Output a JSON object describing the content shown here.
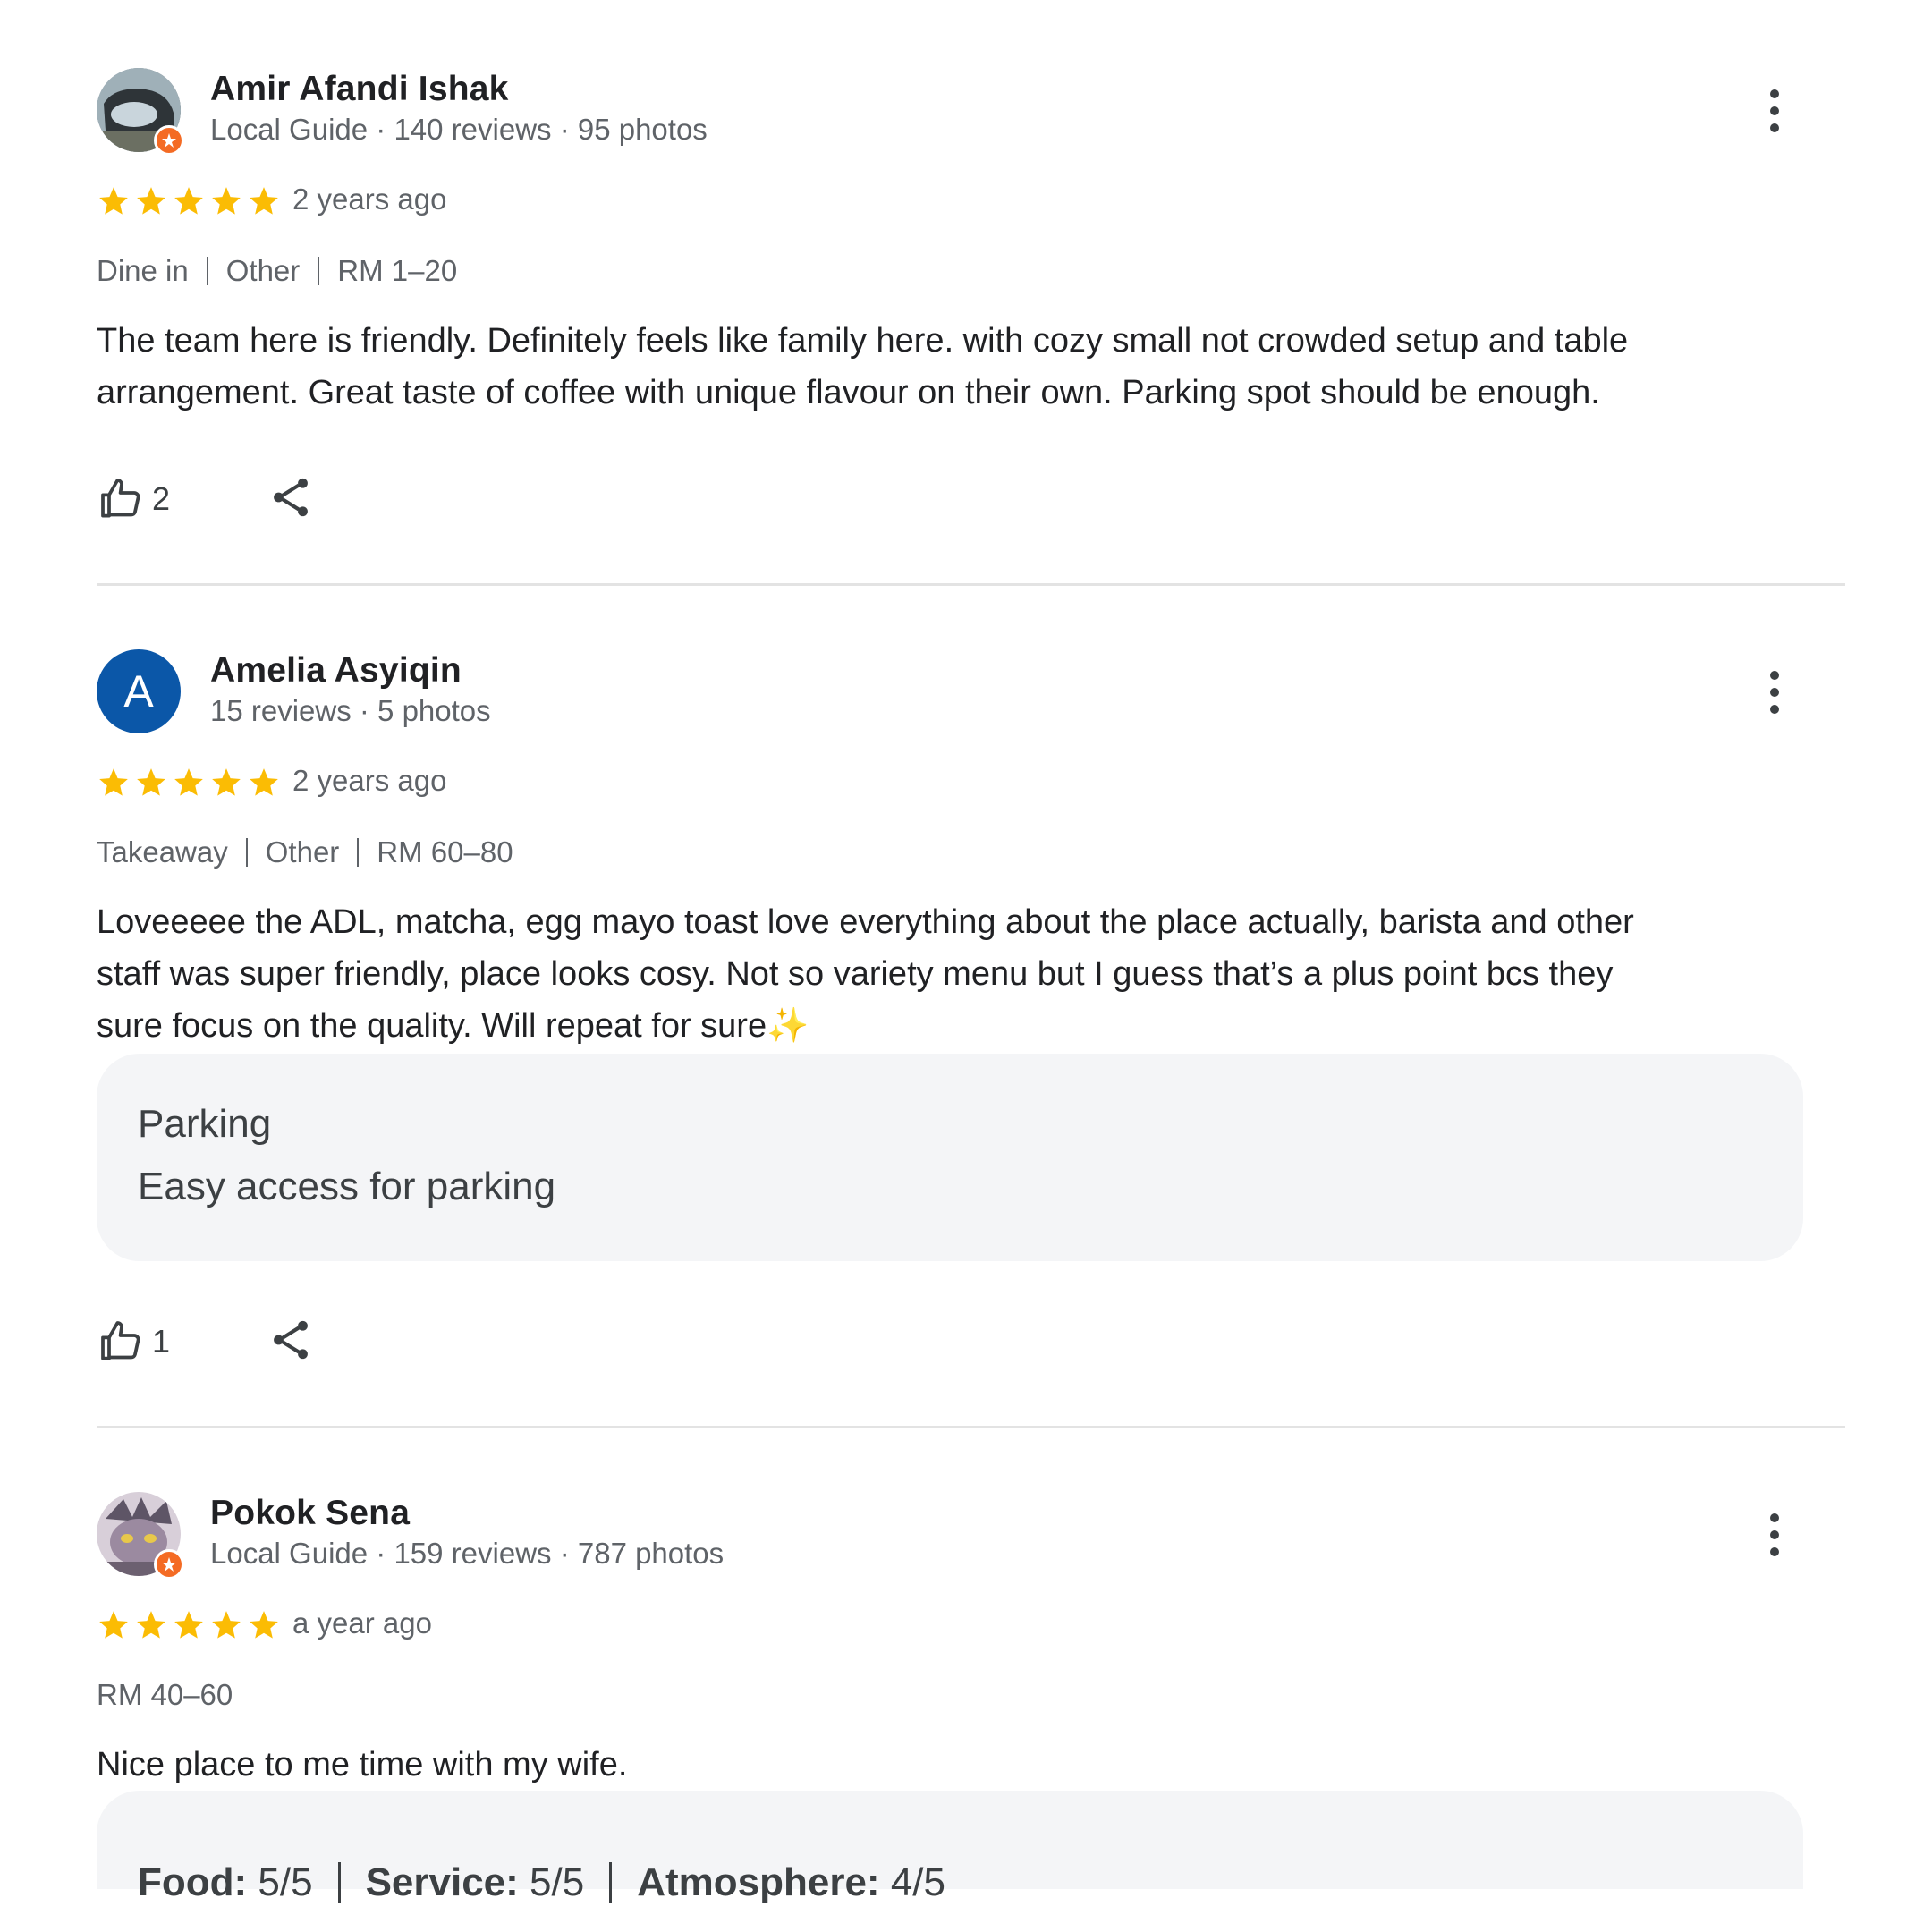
{
  "reviews": [
    {
      "name": "Amir Afandi Ishak",
      "meta": "Local Guide · 140 reviews · 95 photos",
      "rating": 5,
      "when": "2 years ago",
      "tags": [
        "Dine in",
        "Other",
        "RM 1–20"
      ],
      "text_lines": [
        "The team here is friendly. Definitely feels like family here. with cozy small not crowded setup and table",
        "arrangement. Great taste of coffee with unique flavour on their own. Parking spot should be enough."
      ],
      "likes": "2"
    },
    {
      "name": "Amelia Asyiqin",
      "avatar_letter": "A",
      "avatar_color": "#0b57a8",
      "meta": "15 reviews · 5 photos",
      "rating": 5,
      "when": "2 years ago",
      "tags": [
        "Takeaway",
        "Other",
        "RM 60–80"
      ],
      "text_lines": [
        "Loveeeee the ADL, matcha, egg mayo toast love everything about the place actually, barista and other",
        "staff was super friendly, place looks cosy. Not so variety menu but I guess that’s a plus point bcs they",
        "sure focus on the quality. Will repeat for sure✨"
      ],
      "aspect": {
        "title": "Parking",
        "value": "Easy access for parking"
      },
      "likes": "1"
    },
    {
      "name": "Pokok Sena",
      "meta": "Local Guide · 159 reviews · 787 photos",
      "rating": 5,
      "when": "a year ago",
      "tags": [
        "RM 40–60"
      ],
      "text_lines": [
        "Nice place to me time with my wife."
      ],
      "ratings": [
        {
          "label": "Food:",
          "value": "5/5"
        },
        {
          "label": "Service:",
          "value": "5/5"
        },
        {
          "label": "Atmosphere:",
          "value": "4/5"
        }
      ]
    }
  ],
  "colors": {
    "star": "#fbbc04",
    "local_guide_badge": "#f46b24",
    "divider": "#e3e3e3"
  }
}
